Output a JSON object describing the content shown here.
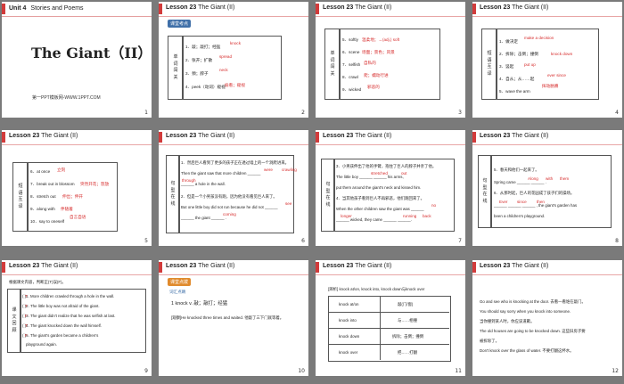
{
  "slides": {
    "s1": {
      "unit": "Unit 4",
      "unit_sub": "Stories and Poems",
      "title": "The Giant（II）",
      "footer": "第一PPT模板网-WWW.1PPT.COM",
      "num": "1"
    },
    "s2": {
      "lesson": "Lesson 23",
      "topic": "The Giant (II)",
      "tag": "课堂考点",
      "label": "单\n词\n闯\n关",
      "lines": [
        "1．敲；敲打；经猛",
        "2．张开；扩散",
        "3．颈；脖子",
        "4．peek（动词）窥视"
      ],
      "answers": [
        "knock",
        "spread",
        "neck",
        "偷看；窥视"
      ],
      "num": "2"
    },
    "s3": {
      "lesson": "Lesson 23",
      "topic": "The Giant (II)",
      "label": "单\n词\n闯\n关",
      "lines": [
        "5．softly",
        "6．scene",
        "7．selfish",
        "8．crawl",
        "9．wicked"
      ],
      "answers": [
        "温柔地；→(adj.) soft",
        "场面；景色；风景",
        "自私的",
        "爬；蠕动行进",
        "邪恶的"
      ],
      "num": "3"
    },
    "s4": {
      "lesson": "Lesson 23",
      "topic": "The Giant (II)",
      "label": "短\n语\n互\n译",
      "lines": [
        "1．做决定",
        "2．拆除；击倒；撞倒",
        "3．竖起",
        "4．自从；从……起",
        "5．wave the arm"
      ],
      "answers": [
        "make a decision",
        "knock down",
        "put up",
        "ever since",
        "挥动胳膊"
      ],
      "num": "4"
    },
    "s5": {
      "lesson": "Lesson 23",
      "topic": "The Giant (II)",
      "label": "短\n语\n互\n译",
      "lines": [
        "6．at once",
        "7．break out in blossom",
        "8．stretch out",
        "9．along with",
        "10．say to oneself"
      ],
      "answers": [
        "立刻",
        "突然开花；怒放",
        "伸出；伸开",
        "伴随着",
        "自言自语"
      ],
      "num": "5"
    },
    "s6": {
      "lesson": "Lesson 23",
      "topic": "The Giant (II)",
      "label": "句\n型\n在\n线",
      "lines": [
        "1．然后巨人看到了更多的孩子正在透过墙上的一个洞爬进来。",
        "Then the giant saw that more children ______",
        "______ a hole in the wall.",
        "2．但是一个小男孩没有跑，因为他没有看见巨人来了。",
        "But one little boy did not run because he did not ______",
        "______ the giant ______ ."
      ],
      "answers": [
        "were",
        "crawling",
        "through",
        "see",
        "coming"
      ],
      "num": "6"
    },
    "s7": {
      "lesson": "Lesson 23",
      "topic": "The Giant (II)",
      "label": "句\n型\n在\n线",
      "lines": [
        "3．小男孩伸出了他的手臂，抱住了巨人的脖子并亲了他。",
        "The little boy ______ ______ his arms,",
        "put them around the giant's neck and kissed him.",
        "4．当其他孩子看到巨人不再邪恶，他们跑回来了。",
        "When the other children saw the giant was ______",
        "______ wicked, they came ______ ______."
      ],
      "answers": [
        "stretched",
        "out",
        "no",
        "longer",
        "running",
        "back"
      ],
      "num": "7"
    },
    "s8": {
      "lesson": "Lesson 23",
      "topic": "The Giant (II)",
      "label": "句\n型\n在\n线",
      "lines": [
        "5．春天和他们一起来了。",
        "Spring came ______ ______ .",
        "6．从那时起，巨人的花园成了孩子们的操场。",
        "______ ______ ______ , the giant's garden has",
        "been a children's playground."
      ],
      "answers": [
        "Along",
        "with",
        "them",
        "Ever",
        "since",
        "then"
      ],
      "num": "8"
    },
    "s9": {
      "lesson": "Lesson 23",
      "topic": "The Giant (II)",
      "intro": "根据课文内容，判断正(T)误(F)。",
      "label": "课\n文\n回\n顾",
      "lines": [
        "(    )1. More children crawled through a hole in the wall.",
        "(    )2. The little boy was not afraid of the giant.",
        "(    )3. The giant didn't realize that he was selfish at last.",
        "(    )4. The giant knocked down the wall himself.",
        "(    )5. The giant's garden became a children's",
        "playground again."
      ],
      "answers": [
        "T",
        "T",
        "F",
        "T",
        "F"
      ],
      "num": "9"
    },
    "s10": {
      "lesson": "Lesson 23",
      "topic": "The Giant (II)",
      "tag": "课堂点拨",
      "sub": "词汇点睛",
      "item": "1    knock v. 敲；敲打；经猛",
      "quote": "[观察]He knocked three times and waited. 他敲了三下门就等着。",
      "num": "10"
    },
    "s11": {
      "lesson": "Lesson 23",
      "topic": "The Giant (II)",
      "intro": "[辨析] knock at/on, knock into, knock down与knock over",
      "rows": [
        [
          "knock at/on",
          "敲(门/窗)"
        ],
        [
          "knock into",
          "与……相撞"
        ],
        [
          "knock down",
          "拆除；击倒；撞倒"
        ],
        [
          "knock over",
          "把……打翻"
        ]
      ],
      "num": "11"
    },
    "s12": {
      "lesson": "Lesson 23",
      "topic": "The Giant (II)",
      "lines": [
        "Go and see who is knocking at the door. 去看一看谁在敲门。",
        "You should say sorry when you knock into someone.",
        "当你撞到某人时，你应该道歉。",
        "The old houses are going to be knocked down. 这些旧房子要",
        "被拆除了。",
        "Don't knock over the glass of water. 不要打翻这杯水。"
      ],
      "num": "12"
    }
  }
}
